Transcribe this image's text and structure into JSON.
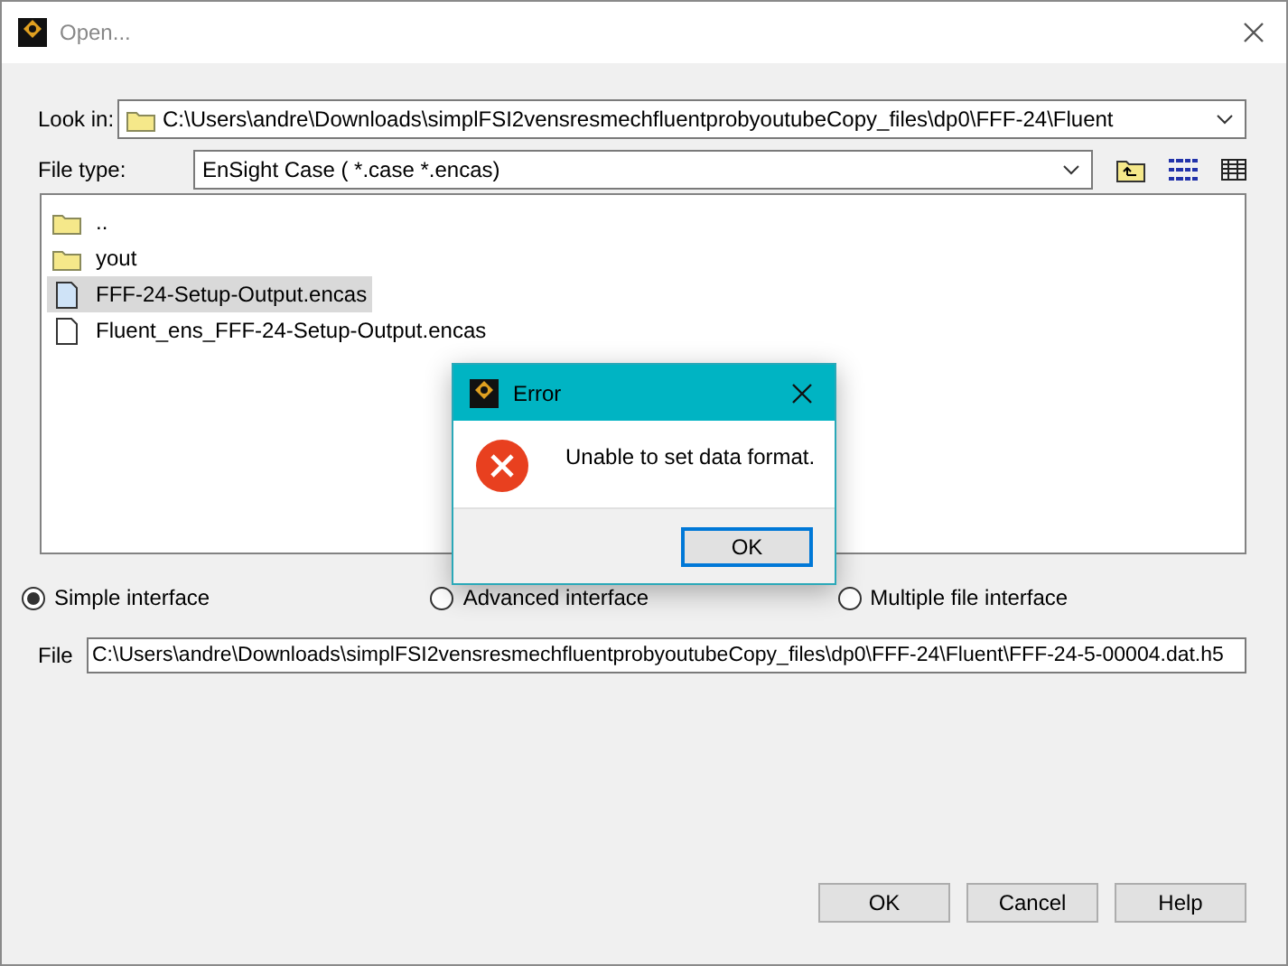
{
  "window": {
    "title": "Open..."
  },
  "look_in": {
    "label": "Look in:",
    "value": "C:\\Users\\andre\\Downloads\\simplFSI2vensresmechfluentprobyoutubeCopy_files\\dp0\\FFF-24\\Fluent"
  },
  "file_type": {
    "label": "File type:",
    "value": "EnSight Case ( *.case *.encas)"
  },
  "files": [
    {
      "name": "..",
      "kind": "folder",
      "selected": false
    },
    {
      "name": "yout",
      "kind": "folder",
      "selected": false
    },
    {
      "name": "FFF-24-Setup-Output.encas",
      "kind": "file",
      "selected": true
    },
    {
      "name": "Fluent_ens_FFF-24-Setup-Output.encas",
      "kind": "file",
      "selected": false
    }
  ],
  "interface_options": [
    {
      "label": "Simple interface",
      "selected": true
    },
    {
      "label": "Advanced interface",
      "selected": false
    },
    {
      "label": "Multiple file interface",
      "selected": false
    }
  ],
  "file_field": {
    "label": "File",
    "value": "C:\\Users\\andre\\Downloads\\simplFSI2vensresmechfluentprobyoutubeCopy_files\\dp0\\FFF-24\\Fluent\\FFF-24-5-00004.dat.h5"
  },
  "buttons": [
    "OK",
    "Cancel",
    "Help"
  ],
  "error_dialog": {
    "title": "Error",
    "message": "Unable to set data format.",
    "button": "OK"
  }
}
